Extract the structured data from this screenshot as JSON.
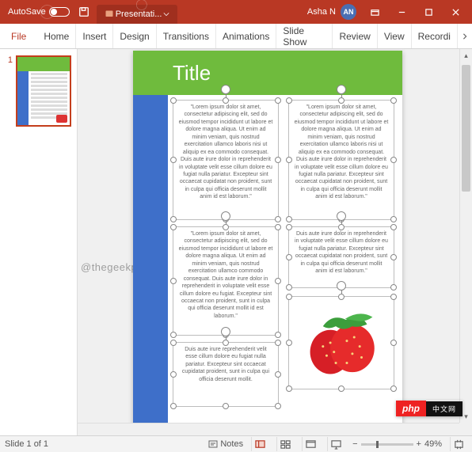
{
  "titlebar": {
    "autosave_label": "AutoSave",
    "autosave_state": "Off",
    "doc_name": "Presentati...",
    "user_name": "Asha N",
    "user_initials": "AN"
  },
  "ribbon": {
    "tabs": [
      "File",
      "Home",
      "Insert",
      "Design",
      "Transitions",
      "Animations",
      "Slide Show",
      "Review",
      "View",
      "Recordi"
    ]
  },
  "thumbnails": {
    "number": "1"
  },
  "slide": {
    "title": "Title",
    "lorem_long": "\"Lorem ipsum dolor sit amet, consectetur adipiscing elit, sed do eiusmod tempor incididunt ut labore et dolore magna aliqua. Ut enim ad minim veniam, quis nostrud exercitation ullamco laboris nisi ut aliquip ex ea commodo consequat. Duis aute irure dolor in reprehenderit in voluptate velit esse cillum dolore eu fugiat nulla pariatur. Excepteur sint occaecat cupidatat non proident, sunt in culpa qui officia deserunt mollit anim id est laborum.\"",
    "lorem_med": "\"Lorem ipsum dolor sit amet, consectetur adipiscing elit, sed do eiusmod tempor incididunt ut labore et dolore magna aliqua. Ut enim ad minim veniam, quis nostrud exercitation ullamco commodo consequat. Duis aute irure dolor in reprehenderit in voluptate velit esse cillum dolore eu fugiat. Excepteur sint occaecat non proident, sunt in culpa qui officia deserunt mollit id est laborum.\"",
    "lorem_short2": "Duis aute irure dolor in reprehenderit in voluptate velit esse cillum dolore eu fugiat nulla pariatur. Excepteur sint occaecat cupidatat non proident, sunt in culpa qui officia deserunt mollit anim id est laborum.\"",
    "lorem_tiny": "Duis aute irure reprehenderit velit esse cillum dolore eu fugiat nulla pariatur. Excepteur sint occaecat cupidatat proident, sunt in culpa qui officia deserunt mollit."
  },
  "watermark": "@thegeekpage.com",
  "badge": {
    "left": "php",
    "right": "中文网"
  },
  "statusbar": {
    "slide_info": "Slide 1 of 1",
    "notes_label": "Notes",
    "zoom_value": "49%"
  }
}
